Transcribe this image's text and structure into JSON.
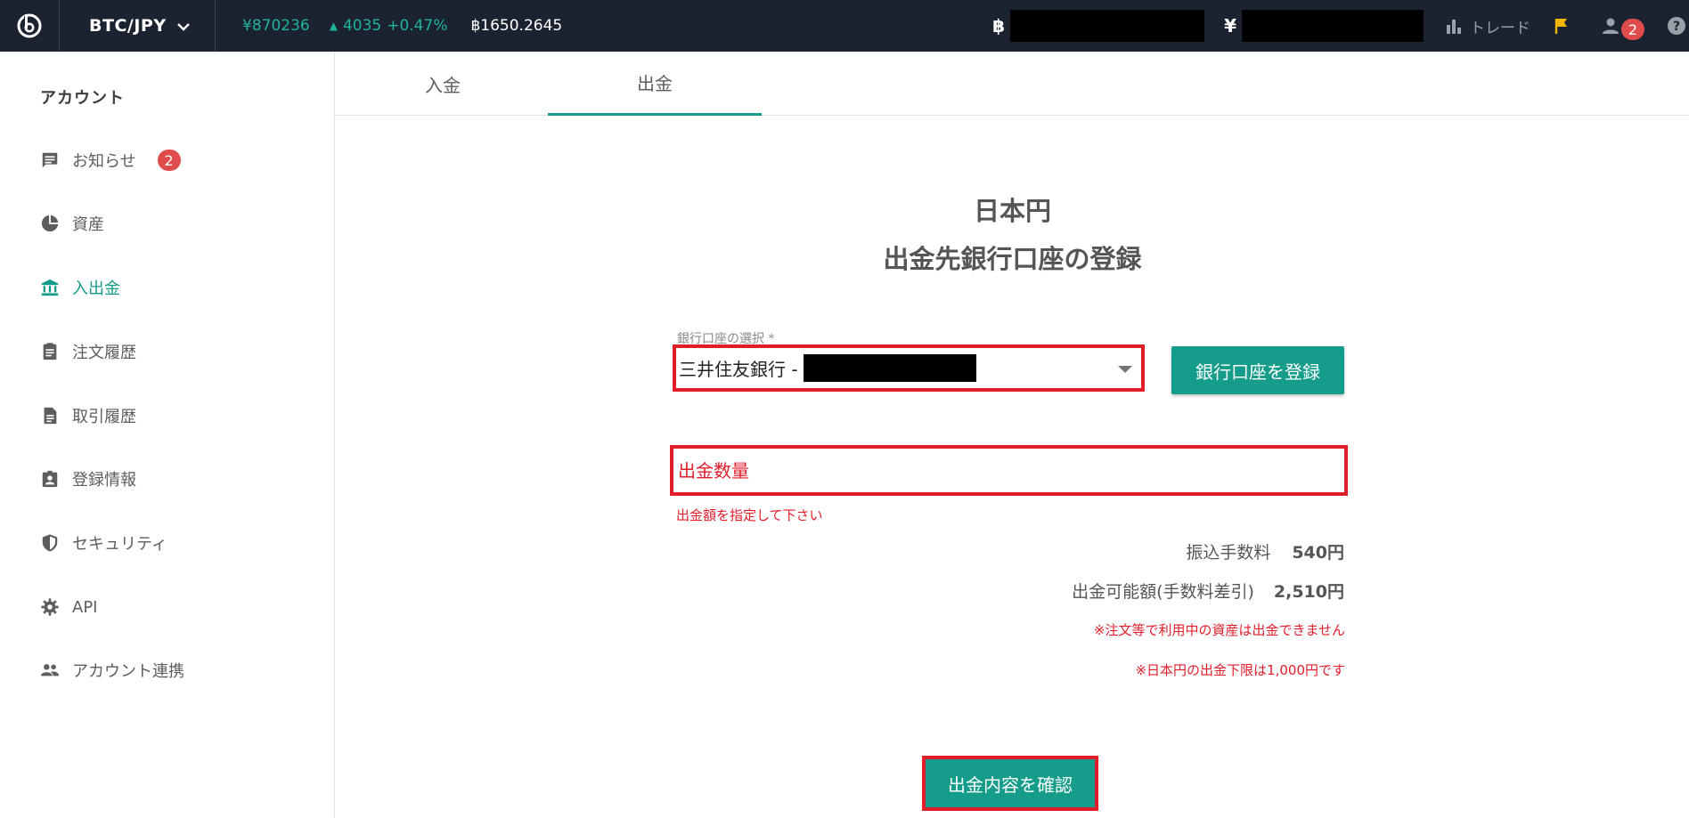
{
  "header": {
    "logo_icon": "bitbank-logo-icon",
    "pair": "BTC/JPY",
    "price": "¥870236",
    "change_amount": "4035",
    "change_percent": "+0.47%",
    "volume": "฿1650.2645",
    "btc_symbol": "฿",
    "jpy_symbol": "¥",
    "trade_label": "トレード",
    "user_badge": "2",
    "accent_green": "#1fb39a",
    "bar_color": "#1c2330"
  },
  "sidebar": {
    "heading": "アカウント",
    "items": [
      {
        "label": "お知らせ",
        "icon": "message-icon",
        "badge": "2"
      },
      {
        "label": "資産",
        "icon": "pie-chart-icon"
      },
      {
        "label": "入出金",
        "icon": "bank-icon"
      },
      {
        "label": "注文履歴",
        "icon": "clipboard-icon"
      },
      {
        "label": "取引履歴",
        "icon": "document-icon"
      },
      {
        "label": "登録情報",
        "icon": "account-box-icon"
      },
      {
        "label": "セキュリティ",
        "icon": "shield-icon"
      },
      {
        "label": "API",
        "icon": "gear-icon"
      },
      {
        "label": "アカウント連携",
        "icon": "people-icon"
      }
    ],
    "active_color": "#149b87"
  },
  "tabs": [
    {
      "label": "入金"
    },
    {
      "label": "出金"
    }
  ],
  "form": {
    "title1": "日本円",
    "title2": "出金先銀行口座の登録",
    "select_label": "銀行口座の選択 *",
    "selected_bank": "三井住友銀行 -",
    "register_button": "銀行口座を登録",
    "amount_placeholder": "出金数量",
    "amount_error": "出金額を指定して下さい",
    "fee_label": "振込手数料",
    "fee_value": "540円",
    "available_label": "出金可能額(手数料差引)",
    "available_value": "2,510円",
    "note1": "※注文等で利用中の資産は出金できません",
    "note2": "※日本円の出金下限は1,000円です",
    "confirm_button": "出金内容を確認",
    "button_color": "#159c8a",
    "highlight_color": "#e21d2a"
  }
}
